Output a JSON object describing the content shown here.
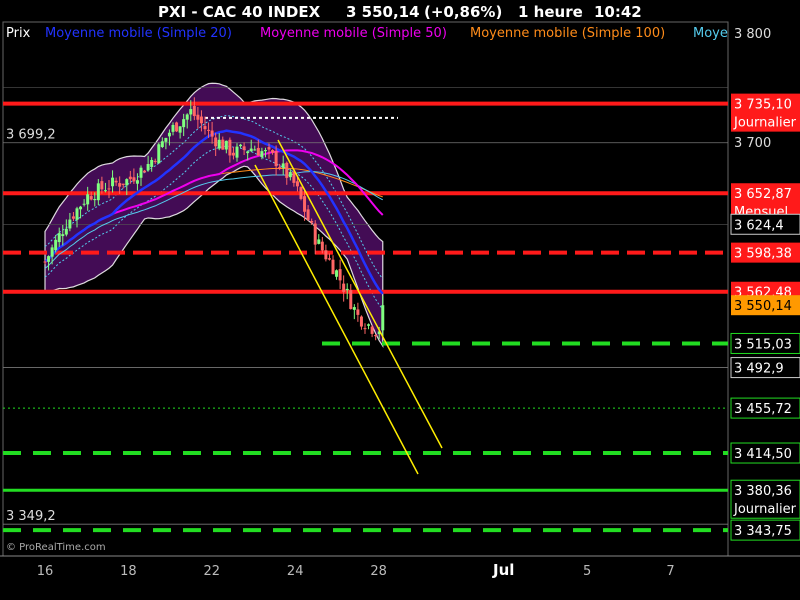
{
  "header": {
    "title": "PXI - CAC 40 INDEX",
    "price": "3 550,14",
    "change": "(+0,86%)",
    "timeframe": "1 heure",
    "time": "10:42"
  },
  "legend": {
    "prix": "Prix",
    "ma20": "Moyenne mobile (Simple 20)",
    "ma50": "Moyenne mobile (Simple 50)",
    "ma100": "Moyenne mobile (Simple 100)",
    "ma_cut": "Moye"
  },
  "watermark": "© ProRealTime.com",
  "colors": {
    "background": "#000000",
    "ma20": "#2233ff",
    "ma50": "#ee00ee",
    "ma100": "#ff8c1a",
    "ma_cyan": "#55ccee",
    "bands": "#4a0d5e",
    "resistance": "#ff1a1a",
    "support": "#22dd22",
    "trendline": "#ffee00"
  },
  "chart_data": {
    "type": "candlestick",
    "instrument": "CAC 40 INDEX",
    "timeframe": "1 heure",
    "ylim": [
      3320,
      3810
    ],
    "y_ticks": [
      {
        "value": 3800,
        "label": "3 800"
      },
      {
        "value": 3700,
        "label": "3 700"
      }
    ],
    "x_ticks": [
      {
        "t": 0,
        "label": "16"
      },
      {
        "t": 2,
        "label": "18"
      },
      {
        "t": 4,
        "label": "22"
      },
      {
        "t": 6,
        "label": "24"
      },
      {
        "t": 8,
        "label": "28"
      },
      {
        "t": 11,
        "label": "Jul"
      },
      {
        "t": 13,
        "label": "5"
      },
      {
        "t": 15,
        "label": "7"
      }
    ],
    "price_labels": [
      {
        "value": 3735.1,
        "label": "3 735,10",
        "note": "Journalier",
        "style": "red"
      },
      {
        "value": 3652.87,
        "label": "3 652,87",
        "note": "Mensuel",
        "style": "red"
      },
      {
        "value": 3624.4,
        "label": "3 624,4",
        "note": "",
        "style": "white"
      },
      {
        "value": 3598.38,
        "label": "3 598,38",
        "note": "",
        "style": "red"
      },
      {
        "value": 3562.48,
        "label": "3 562,48",
        "note": "",
        "style": "red"
      },
      {
        "value": 3550.14,
        "label": "3 550,14",
        "note": "",
        "style": "orange"
      },
      {
        "value": 3515.03,
        "label": "3 515,03",
        "note": "",
        "style": "green"
      },
      {
        "value": 3492.9,
        "label": "3 492,9",
        "note": "",
        "style": "white"
      },
      {
        "value": 3455.72,
        "label": "3 455,72",
        "note": "",
        "style": "green"
      },
      {
        "value": 3414.5,
        "label": "3 414,50",
        "note": "",
        "style": "green"
      },
      {
        "value": 3380.36,
        "label": "3 380,36",
        "note": "Journalier",
        "style": "green"
      },
      {
        "value": 3343.75,
        "label": "3 343,75",
        "note": "",
        "style": "green"
      }
    ],
    "extremes": [
      {
        "value": 3699.2,
        "label": "3 699,2"
      },
      {
        "value": 3349.2,
        "label": "3 349,2"
      }
    ],
    "hlines": [
      {
        "value": 3735.1,
        "kind": "red-solid"
      },
      {
        "value": 3652.87,
        "kind": "red-solid"
      },
      {
        "value": 3598.38,
        "kind": "red-dashed"
      },
      {
        "value": 3562.48,
        "kind": "red-solid"
      },
      {
        "value": 3515.03,
        "kind": "green-dashed"
      },
      {
        "value": 3455.72,
        "kind": "green-dotted"
      },
      {
        "value": 3414.5,
        "kind": "green-dashed"
      },
      {
        "value": 3380.36,
        "kind": "green-solid"
      },
      {
        "value": 3343.75,
        "kind": "green-dashed"
      }
    ],
    "series": [
      {
        "name": "Prix"
      },
      {
        "name": "Moyenne mobile (Simple 20)"
      },
      {
        "name": "Moyenne mobile (Simple 50)"
      },
      {
        "name": "Moyenne mobile (Simple 100)"
      }
    ],
    "last_price": 3550.14,
    "grid": false
  }
}
